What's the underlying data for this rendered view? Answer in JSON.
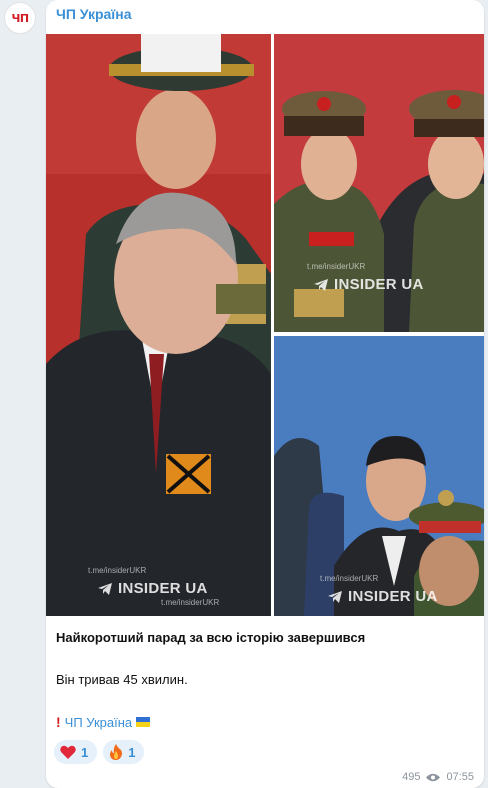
{
  "channel": {
    "avatar_text": "ЧП",
    "name": "ЧП Україна"
  },
  "media": {
    "watermark_handle": "t.me/insiderUKR",
    "watermark_brand": "INSIDER UA",
    "watermark_handle_2": "t.me/insiderUKR"
  },
  "post": {
    "title": "Найкоротший парад за всю історію завершився",
    "body": "Він тривав 45 хвилин.",
    "signature": "ЧП Україна"
  },
  "reactions": [
    {
      "icon": "heart-icon",
      "count": "1"
    },
    {
      "icon": "fire-icon",
      "count": "1"
    }
  ],
  "meta": {
    "views": "495",
    "time": "07:55"
  },
  "colors": {
    "accent": "#3a8fd6",
    "bubble": "#ffffff",
    "background": "#e9eef2",
    "reaction_bg": "#e5f0fa"
  }
}
